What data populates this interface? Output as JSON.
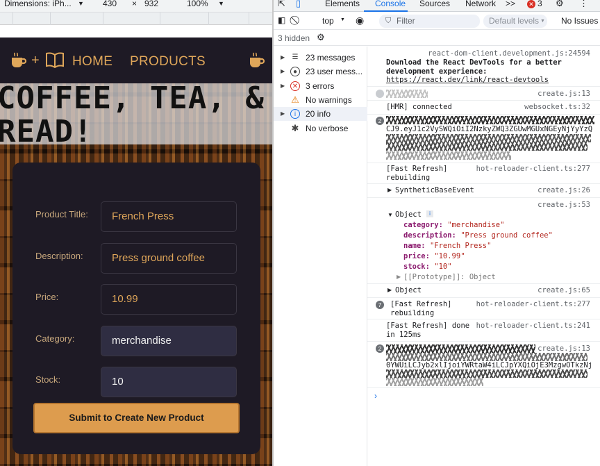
{
  "device_toolbar": {
    "dimensions_label": "Dimensions: iPh...",
    "width": "430",
    "height": "932",
    "zoom": "100%"
  },
  "app": {
    "nav": {
      "home": "HOME",
      "products": "PRODUCTS",
      "logo_plus": "+"
    },
    "hero_title": "COFFEE, TEA, & READ!",
    "form": {
      "title_label": "Product Title:",
      "title_value": "French Press",
      "description_label": "Description:",
      "description_value": "Press ground coffee",
      "price_label": "Price:",
      "price_value": "10.99",
      "category_label": "Category:",
      "category_value": "merchandise",
      "stock_label": "Stock:",
      "stock_value": "10",
      "submit_label": "Submit to Create New Product"
    }
  },
  "devtools": {
    "tabs": [
      "Elements",
      "Console",
      "Sources",
      "Network",
      ">>"
    ],
    "active_tab": "Console",
    "error_count": "3",
    "context": "top",
    "filter_placeholder": "Filter",
    "levels": "Default levels",
    "issues": "No Issues",
    "hidden": "3 hidden",
    "sidebar": [
      {
        "label": "23 messages",
        "icon": "list-icon"
      },
      {
        "label": "23 user mess...",
        "icon": "user-icon"
      },
      {
        "label": "3 errors",
        "icon": "error-icon"
      },
      {
        "label": "No warnings",
        "icon": "warning-icon"
      },
      {
        "label": "20 info",
        "icon": "info-icon"
      },
      {
        "label": "No verbose",
        "icon": "bug-icon"
      }
    ],
    "console": {
      "m0_src": "react-dom-client.development.js:24594",
      "m0_text": "Download the React DevTools for a better\ndevelopment experience:",
      "m0_link": "https://react.dev/link/react-devtools",
      "m1_src": "create.js:13",
      "m2_text": "[HMR] connected",
      "m2_src": "websocket.ts:32",
      "m3_badge": "2",
      "m3_text": "CJ9.eyJ1c2VySWQiOiI2NzkyZWQ3ZGUwMGUxNGEyNjYyYzQ",
      "m4_text": "[Fast Refresh]\nrebuilding",
      "m4_src": "hot-reloader-client.ts:277",
      "m5_text": "SyntheticBaseEvent",
      "m5_src": "create.js:26",
      "m6_src": "create.js:53",
      "obj_title": "Object",
      "obj_category": "\"merchandise\"",
      "obj_description": "\"Press ground coffee\"",
      "obj_name": "\"French Press\"",
      "obj_price": "\"10.99\"",
      "obj_stock": "\"10\"",
      "obj_proto": "[[Prototype]]: Object",
      "m7_text": "Object",
      "m7_src": "create.js:65",
      "m8_badge": "7",
      "m8_text": "[Fast Refresh]\nrebuilding",
      "m8_src": "hot-reloader-client.ts:277",
      "m9_text": "[Fast Refresh] done\nin 125ms",
      "m9_src": "hot-reloader-client.ts:241",
      "m10_badge": "2",
      "m10_src": "create.js:13",
      "m10_text": "0YWUiLCJyb2xlIjoiYWRtaW4iLCJpYXQiOjE3MzgwOTkzNj"
    }
  },
  "colors": {
    "accent": "#e0a75a",
    "card": "#1e1a25",
    "button": "#dd9c4e",
    "devtools_blue": "#1a73e8"
  }
}
